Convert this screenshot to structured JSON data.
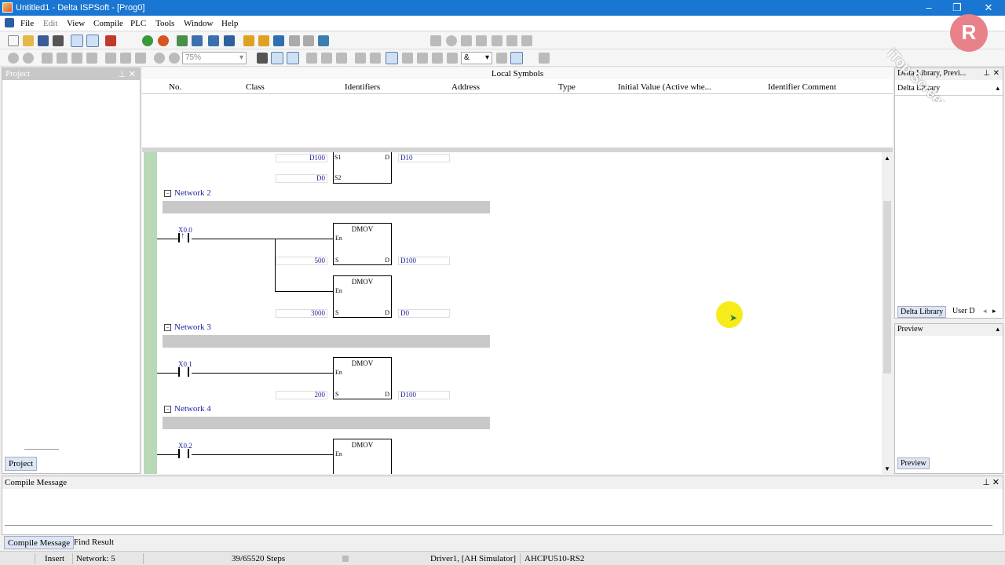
{
  "window": {
    "title": "Untitled1 - Delta ISPSoft - [Prog0]"
  },
  "menu": [
    "File",
    "Edit",
    "View",
    "Compile",
    "PLC",
    "Tools",
    "Window",
    "Help"
  ],
  "toolbar": {
    "zoom": "75%",
    "logic_select": "&"
  },
  "project_panel": {
    "title": "Project",
    "tab": "Project"
  },
  "local_symbols": {
    "caption": "Local Symbols",
    "columns": [
      "No.",
      "Class",
      "Identifiers",
      "Address",
      "Type",
      "Initial Value (Active whe...",
      "Identifier Comment"
    ]
  },
  "ladder": {
    "top_partial": {
      "s1": "D100",
      "s2": "D0",
      "d": "D10",
      "pin_s1": "S1",
      "pin_s2": "S2",
      "pin_d": "D"
    },
    "networks": [
      {
        "label": "Network 2",
        "contact": "X0.0",
        "blocks": [
          {
            "name": "DMOV",
            "en": "En",
            "s": "S",
            "d": "D",
            "src": "500",
            "dst": "D100"
          },
          {
            "name": "DMOV",
            "en": "En",
            "s": "S",
            "d": "D",
            "src": "3000",
            "dst": "D0"
          }
        ]
      },
      {
        "label": "Network 3",
        "contact": "X0.1",
        "blocks": [
          {
            "name": "DMOV",
            "en": "En",
            "s": "S",
            "d": "D",
            "src": "200",
            "dst": "D100"
          }
        ]
      },
      {
        "label": "Network 4",
        "contact": "X0.2",
        "blocks": [
          {
            "name": "DMOV",
            "en": "En"
          }
        ]
      }
    ]
  },
  "library_panel": {
    "title": "Delta Library, Previ...",
    "header": "Delta Library",
    "tab_active": "Delta Library",
    "tab_other": "User D"
  },
  "preview_panel": {
    "header": "Preview",
    "tab": "Preview"
  },
  "compile_panel": {
    "title": "Compile Message"
  },
  "bottom_tabs": [
    "Compile Message",
    "Find Result"
  ],
  "status": {
    "mode": "Insert",
    "network": "Network: 5",
    "steps": "39/65520 Steps",
    "driver": "Driver1, [AH Simulator]",
    "cpu": "AHCPU510-RS2"
  },
  "watermark": {
    "text": "iTop Screen Recorder"
  }
}
